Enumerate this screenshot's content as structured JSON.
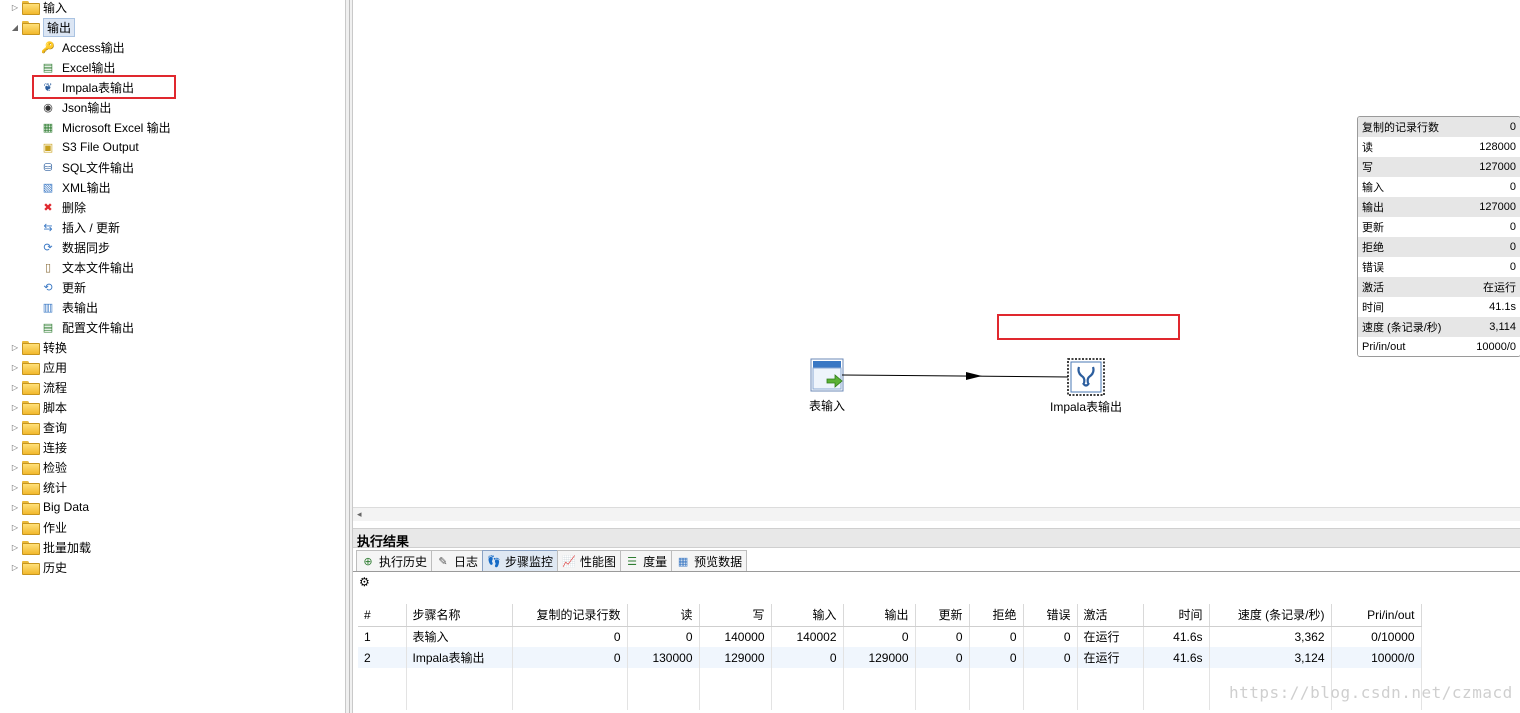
{
  "tree": {
    "categories_top": [
      {
        "label": "输入",
        "expanded": false
      },
      {
        "label": "输出",
        "expanded": true
      }
    ],
    "output_items": [
      {
        "label": "Access输出",
        "icon": "key-icon"
      },
      {
        "label": "Excel输出",
        "icon": "excel-icon"
      },
      {
        "label": "Impala表输出",
        "icon": "impala-icon"
      },
      {
        "label": "Json输出",
        "icon": "json-icon"
      },
      {
        "label": "Microsoft Excel 输出",
        "icon": "ms-excel-icon"
      },
      {
        "label": "S3 File Output",
        "icon": "s3-icon"
      },
      {
        "label": "SQL文件输出",
        "icon": "sql-icon"
      },
      {
        "label": "XML输出",
        "icon": "xml-icon"
      },
      {
        "label": "删除",
        "icon": "delete-icon"
      },
      {
        "label": "插入 / 更新",
        "icon": "insert-update-icon"
      },
      {
        "label": "数据同步",
        "icon": "sync-icon"
      },
      {
        "label": "文本文件输出",
        "icon": "text-file-icon"
      },
      {
        "label": "更新",
        "icon": "update-icon"
      },
      {
        "label": "表输出",
        "icon": "table-output-icon"
      },
      {
        "label": "配置文件输出",
        "icon": "config-file-icon"
      }
    ],
    "categories_bottom": [
      "转换",
      "应用",
      "流程",
      "脚本",
      "查询",
      "连接",
      "检验",
      "统计",
      "Big Data",
      "作业",
      "批量加载",
      "历史"
    ]
  },
  "canvas": {
    "stats": [
      {
        "k": "复制的记录行数",
        "v": "0"
      },
      {
        "k": "读",
        "v": "128000"
      },
      {
        "k": "写",
        "v": "127000"
      },
      {
        "k": "输入",
        "v": "0"
      },
      {
        "k": "输出",
        "v": "127000"
      },
      {
        "k": "更新",
        "v": "0"
      },
      {
        "k": "拒绝",
        "v": "0"
      },
      {
        "k": "错误",
        "v": "0"
      },
      {
        "k": "激活",
        "v": "在运行"
      },
      {
        "k": "时间",
        "v": "41.1s"
      },
      {
        "k": "速度 (条记录/秒)",
        "v": "3,114"
      },
      {
        "k": "Pri/in/out",
        "v": "10000/0"
      }
    ],
    "step_input": "表输入",
    "step_output": "Impala表输出"
  },
  "results": {
    "title": "执行结果",
    "tabs": [
      {
        "label": "执行历史",
        "icon": "history-icon"
      },
      {
        "label": "日志",
        "icon": "log-icon"
      },
      {
        "label": "步骤监控",
        "icon": "step-monitor-icon",
        "active": true
      },
      {
        "label": "性能图",
        "icon": "perf-chart-icon"
      },
      {
        "label": "度量",
        "icon": "metrics-icon"
      },
      {
        "label": "预览数据",
        "icon": "preview-icon"
      }
    ],
    "columns": [
      "#",
      "步骤名称",
      "复制的记录行数",
      "读",
      "写",
      "输入",
      "输出",
      "更新",
      "拒绝",
      "错误",
      "激活",
      "时间",
      "速度 (条记录/秒)",
      "Pri/in/out"
    ],
    "rows": [
      [
        "1",
        "表输入",
        "0",
        "0",
        "140000",
        "140002",
        "0",
        "0",
        "0",
        "0",
        "在运行",
        "41.6s",
        "3,362",
        "0/10000"
      ],
      [
        "2",
        "Impala表输出",
        "0",
        "130000",
        "129000",
        "0",
        "129000",
        "0",
        "0",
        "0",
        "在运行",
        "41.6s",
        "3,124",
        "10000/0"
      ]
    ]
  },
  "watermark": "https://blog.csdn.net/czmacd"
}
